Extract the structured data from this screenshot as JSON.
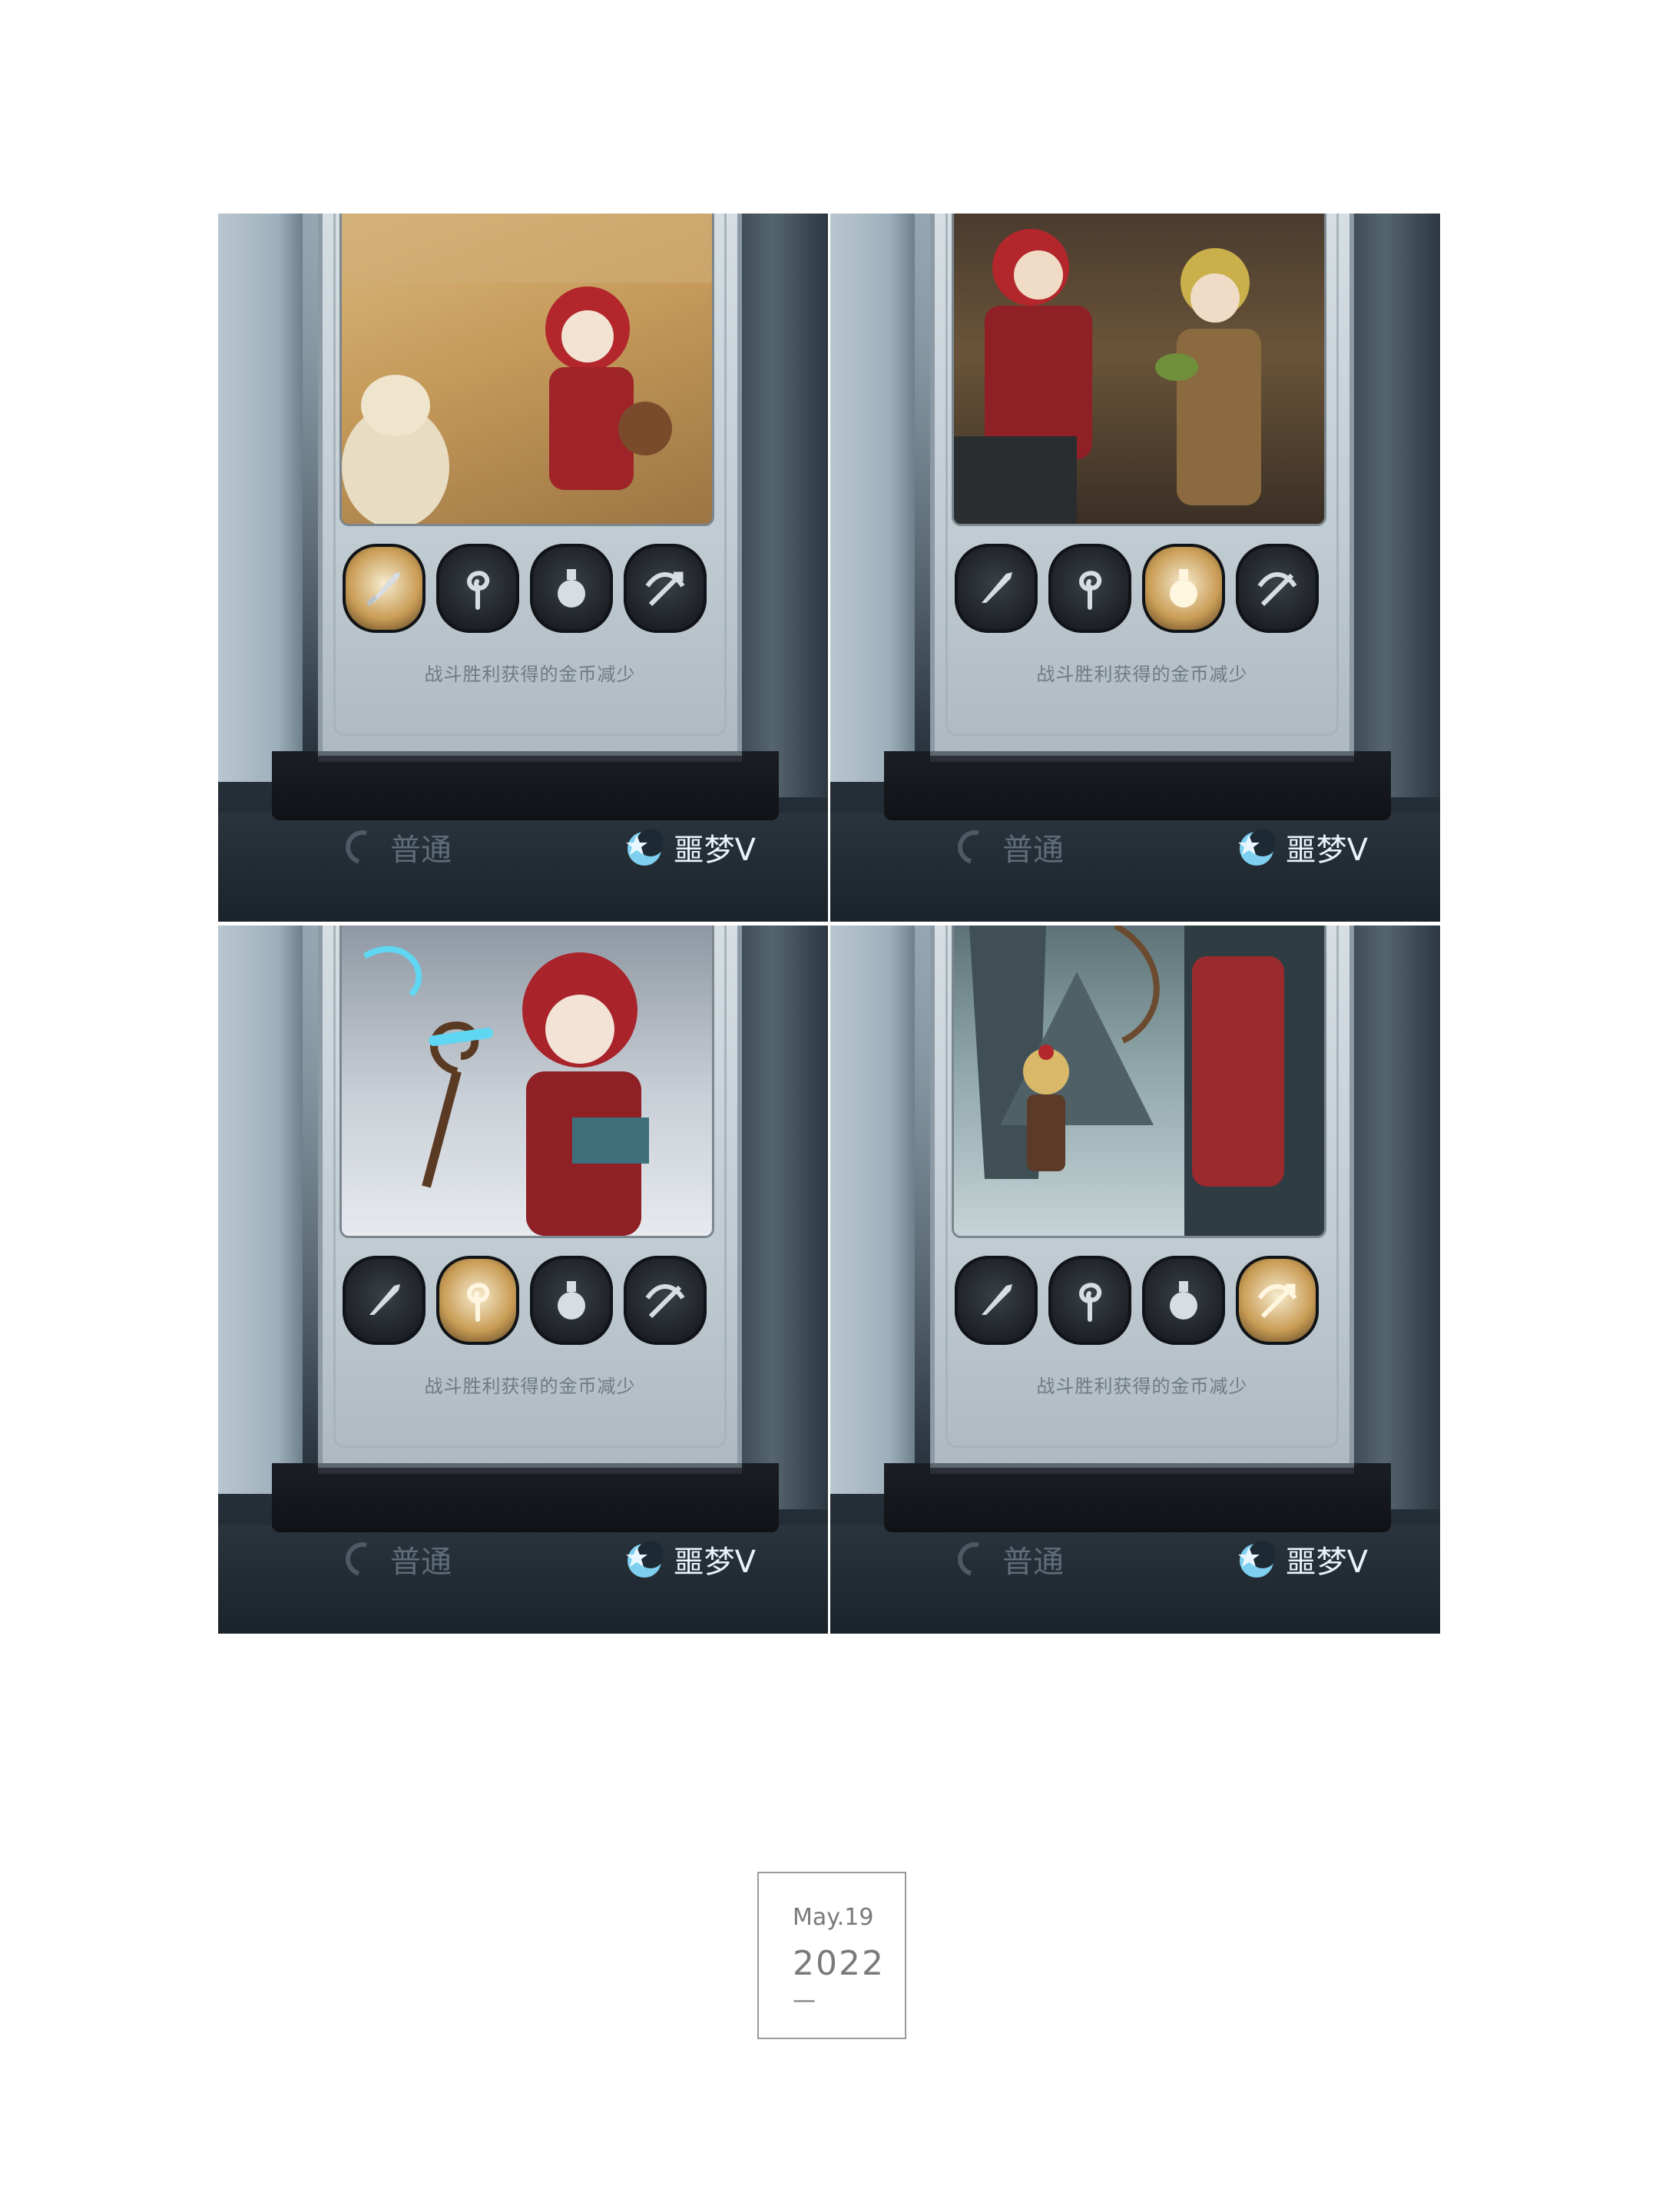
{
  "panels": [
    {
      "active_skill": 0,
      "caption": "战斗胜利获得的金币减少",
      "modes": {
        "normal": "普通",
        "nightmare": "噩梦V"
      }
    },
    {
      "active_skill": 2,
      "caption": "战斗胜利获得的金币减少",
      "modes": {
        "normal": "普通",
        "nightmare": "噩梦V"
      }
    },
    {
      "active_skill": 1,
      "caption": "战斗胜利获得的金币减少",
      "modes": {
        "normal": "普通",
        "nightmare": "噩梦V"
      }
    },
    {
      "active_skill": 3,
      "caption": "战斗胜利获得的金币减少",
      "modes": {
        "normal": "普通",
        "nightmare": "噩梦V"
      }
    }
  ],
  "skills": [
    "sword-icon",
    "spiral-staff-icon",
    "potion-flask-icon",
    "crossbow-icon"
  ],
  "date": {
    "month_day": "May.19",
    "year": "2022",
    "dash": "—"
  },
  "colors": {
    "active_glow": "#f2e3b8",
    "nightmare_text": "#e8f4fb",
    "normal_text": "#5f6d78"
  }
}
